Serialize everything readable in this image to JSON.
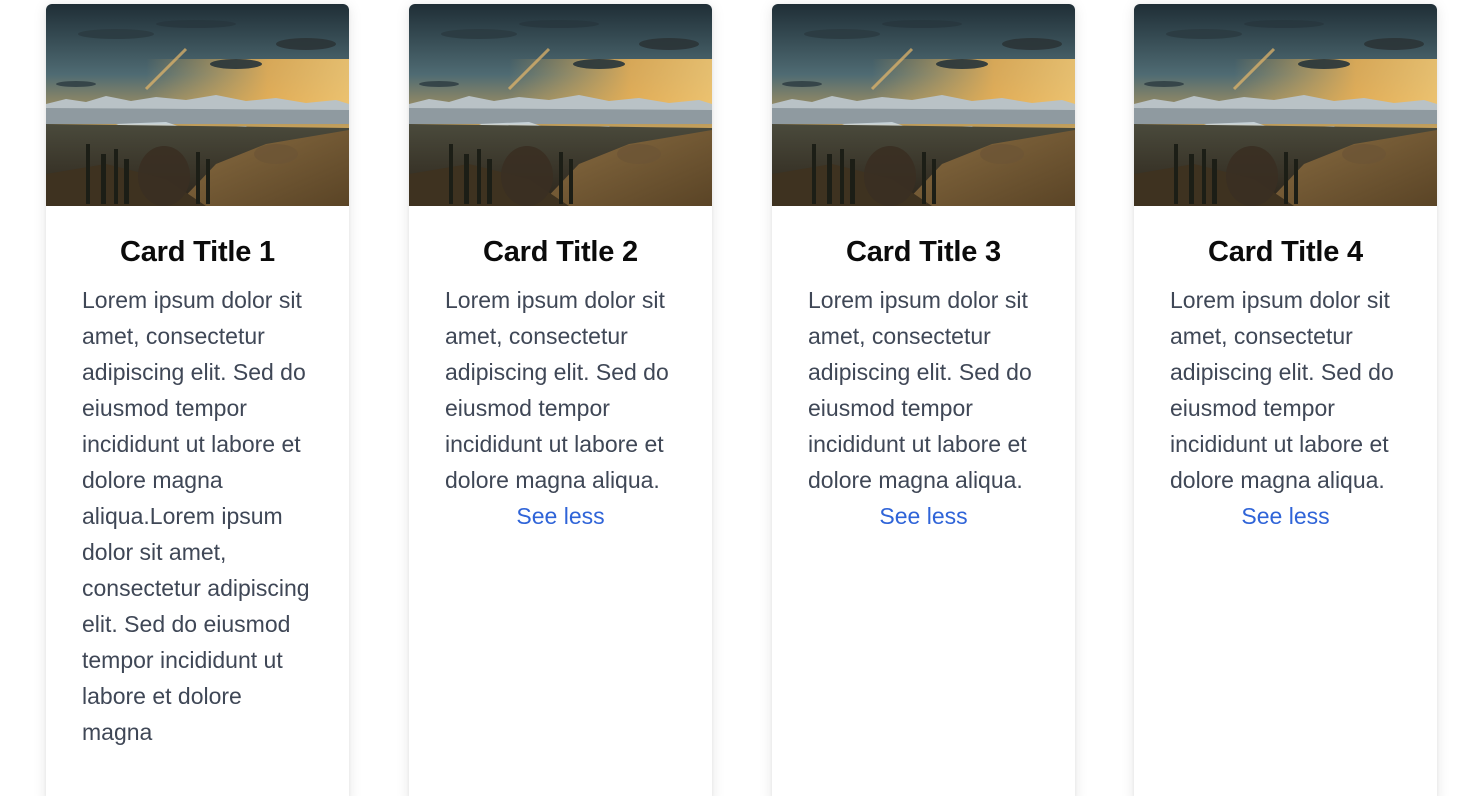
{
  "colors": {
    "title": "#0b0b0b",
    "body_text": "#3f4756",
    "link": "#2f64d8",
    "card_background": "#ffffff"
  },
  "image": {
    "description_icon": "mountain-landscape-image"
  },
  "cards": [
    {
      "title": "Card Title 1",
      "text": "Lorem ipsum dolor sit amet, consectetur adipiscing elit. Sed do eiusmod tempor incididunt ut labore et dolore magna aliqua.Lorem ipsum dolor sit amet, consectetur adipiscing elit. Sed do eiusmod tempor incididunt ut labore et dolore magna",
      "toggle_label": ""
    },
    {
      "title": "Card Title 2",
      "text": "Lorem ipsum dolor sit amet, consectetur adipiscing elit. Sed do eiusmod tempor incididunt ut labore et dolore magna aliqua.",
      "toggle_label": "See less"
    },
    {
      "title": "Card Title 3",
      "text": "Lorem ipsum dolor sit amet, consectetur adipiscing elit. Sed do eiusmod tempor incididunt ut labore et dolore magna aliqua.",
      "toggle_label": "See less"
    },
    {
      "title": "Card Title 4",
      "text": "Lorem ipsum dolor sit amet, consectetur adipiscing elit. Sed do eiusmod tempor incididunt ut labore et dolore magna aliqua.",
      "toggle_label": "See less"
    }
  ]
}
